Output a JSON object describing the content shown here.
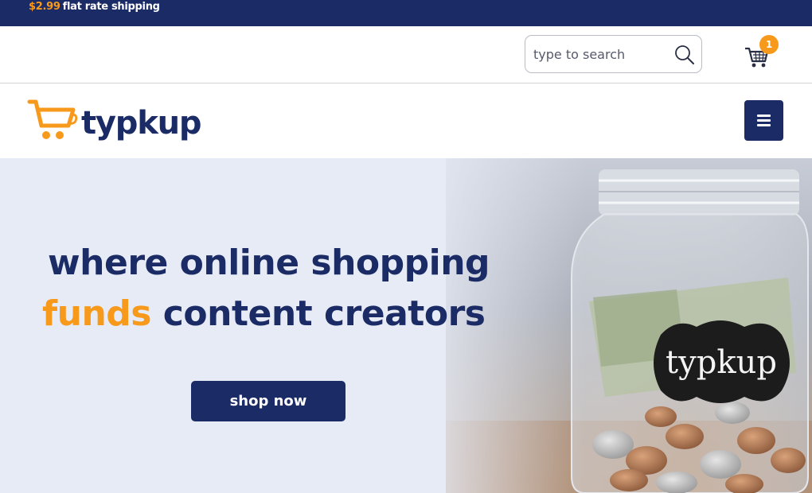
{
  "topbar": {
    "price": "$2.99",
    "promo_text": "flat rate shipping"
  },
  "search": {
    "placeholder": "type to search",
    "value": ""
  },
  "cart": {
    "count": "1",
    "icon": "cart-icon"
  },
  "brand": {
    "name": "typkup",
    "icon": "cart-logo-icon"
  },
  "nav": {
    "menu_icon": "hamburger-icon"
  },
  "hero": {
    "headline_line1": "where online shopping",
    "headline_accent": "funds",
    "headline_rest": " content creators",
    "cta_label": "shop now",
    "jar_label": "typkup"
  },
  "colors": {
    "navy": "#1b2b65",
    "orange": "#f79a1c",
    "hero_bg": "#e7ebf5"
  }
}
